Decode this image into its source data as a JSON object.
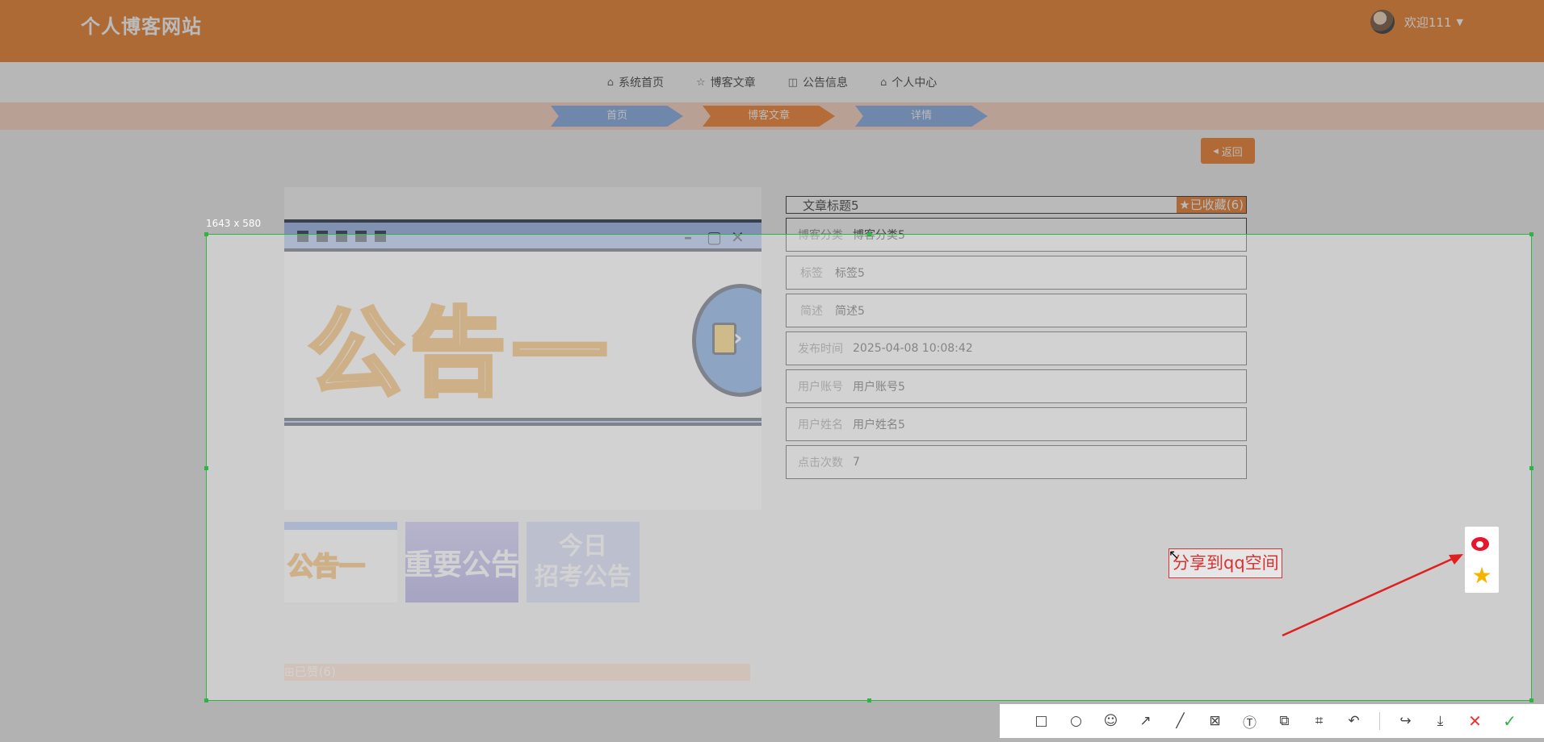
{
  "header": {
    "site_title": "个人博客网站",
    "welcome": "欢迎111"
  },
  "nav": [
    {
      "label": "系统首页",
      "icon": "home-icon"
    },
    {
      "label": "博客文章",
      "icon": "star-icon"
    },
    {
      "label": "公告信息",
      "icon": "bag-icon"
    },
    {
      "label": "个人中心",
      "icon": "home-icon"
    }
  ],
  "breadcrumb": [
    "首页",
    "博客文章",
    "详情"
  ],
  "back_button": "返回",
  "gallery": {
    "banner_text": "公告一",
    "thumbs": [
      "公告一",
      "重要公告",
      "今日",
      "招考公告"
    ]
  },
  "like_text": "已赞(6)",
  "article": {
    "title": "文章标题5",
    "favorite": "已收藏(6)",
    "fields": [
      {
        "key": "博客分类",
        "value": "博客分类5"
      },
      {
        "key": "标签",
        "value": "标签5"
      },
      {
        "key": "简述",
        "value": "简述5"
      },
      {
        "key": "发布时间",
        "value": "2025-04-08 10:08:42"
      },
      {
        "key": "用户账号",
        "value": "用户账号5"
      },
      {
        "key": "用户姓名",
        "value": "用户姓名5"
      },
      {
        "key": "点击次数",
        "value": "7"
      }
    ]
  },
  "screenshot_tool": {
    "size_label": "1643 x 580",
    "annotation_text": "分享到qq空间",
    "tools": [
      "rectangle",
      "ellipse",
      "emoji",
      "arrow",
      "line",
      "mosaic",
      "text",
      "sticker",
      "ocr",
      "undo",
      "share",
      "save",
      "cancel",
      "confirm"
    ]
  },
  "colors": {
    "brand": "#e9751a",
    "accent_blue": "#7da7e6",
    "selection": "#2fb344",
    "annotation": "#d93232"
  }
}
